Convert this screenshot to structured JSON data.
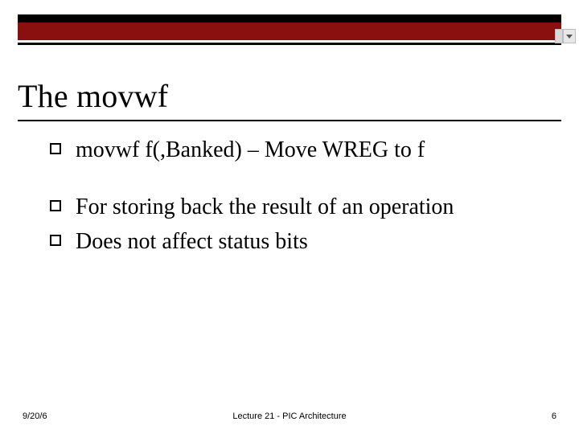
{
  "title": "The movwf",
  "bullets": [
    "movwf   f(,Banked) – Move WREG to f",
    "For storing back the result of an operation",
    "Does not affect status bits"
  ],
  "footer": {
    "left": "9/20/6",
    "center": "Lecture 21 - PIC Architecture",
    "right": "6"
  }
}
